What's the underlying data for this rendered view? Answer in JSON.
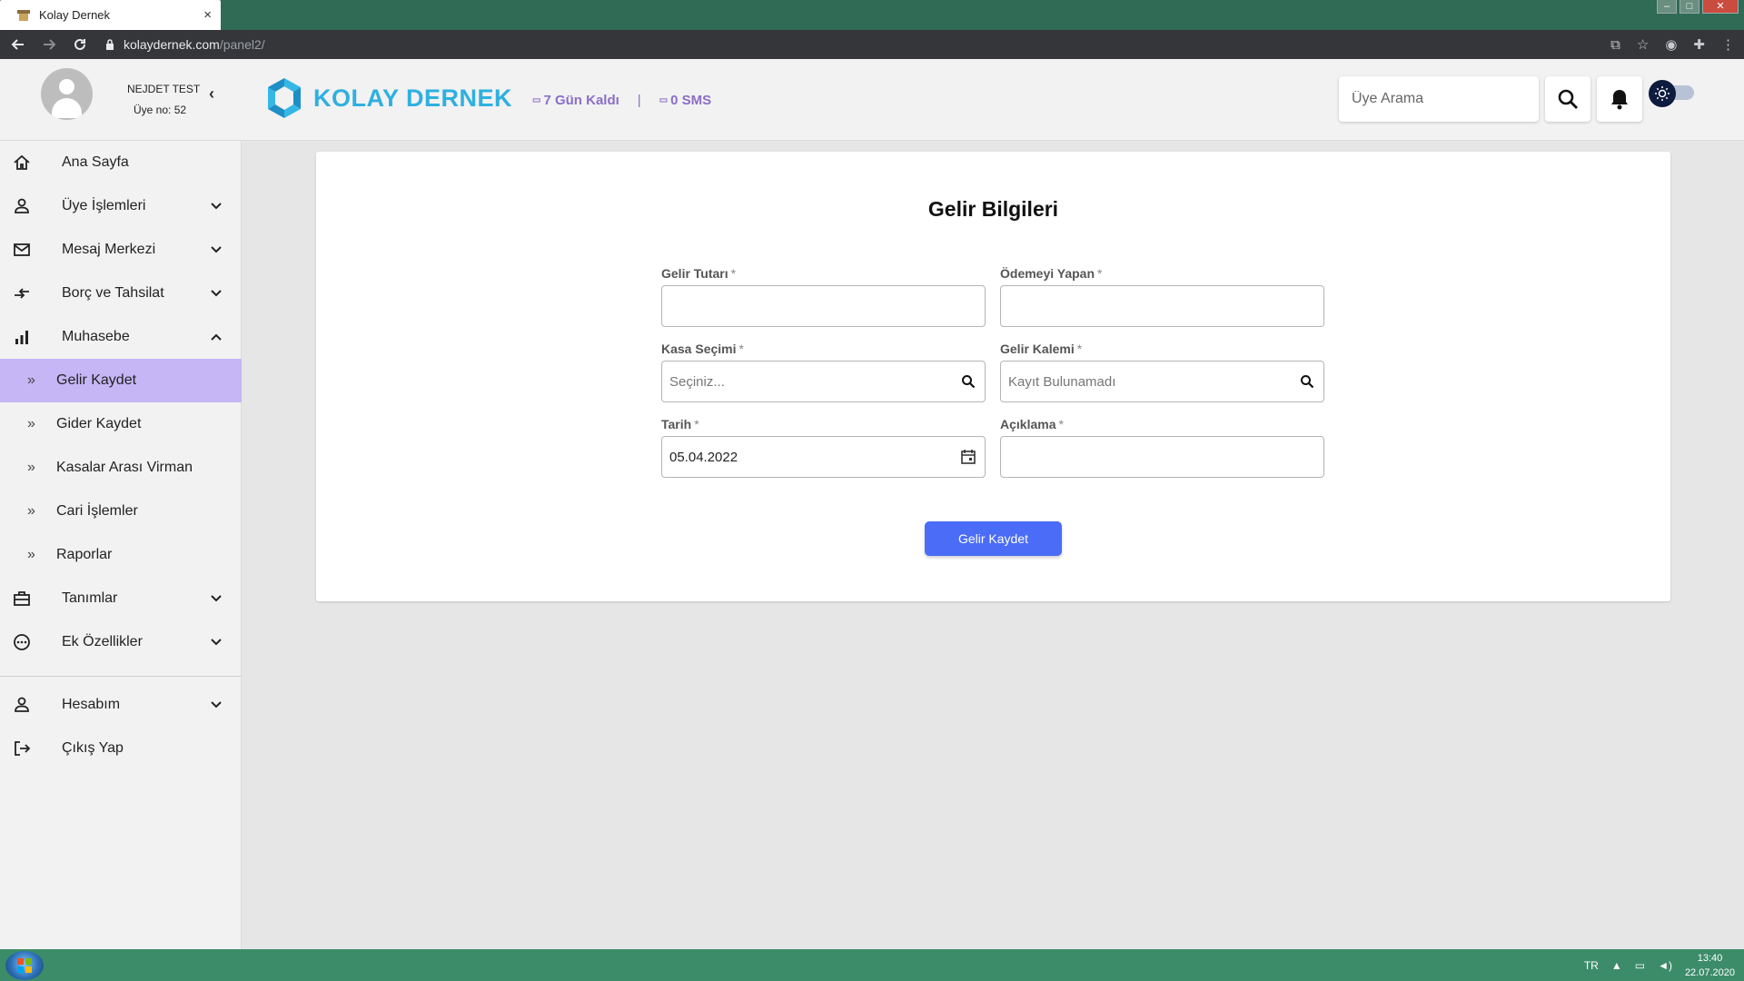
{
  "browser": {
    "tab_title": "Kolay Dernek",
    "tab_close": "×",
    "url_host": "kolaydernek.com",
    "url_path": "/panel2/"
  },
  "header": {
    "user_name": "NEJDET TEST",
    "user_no": "Üye no: 52",
    "logo_text": "KOLAY DERNEK",
    "trial_days": "7 Gün Kaldı",
    "separator": "|",
    "sms_count": "0 SMS",
    "search_placeholder": "Üye Arama"
  },
  "sidebar": {
    "items": [
      {
        "label": "Ana Sayfa",
        "icon": "home-icon",
        "has_chevron": false
      },
      {
        "label": "Üye İşlemleri",
        "icon": "person-icon",
        "has_chevron": true
      },
      {
        "label": "Mesaj Merkezi",
        "icon": "mail-icon",
        "has_chevron": true
      },
      {
        "label": "Borç ve Tahsilat",
        "icon": "transfer-icon",
        "has_chevron": true
      },
      {
        "label": "Muhasebe",
        "icon": "bar-chart-icon",
        "has_chevron": true,
        "expanded": true
      }
    ],
    "sub_items": [
      {
        "label": "Gelir Kaydet",
        "active": true
      },
      {
        "label": "Gider Kaydet"
      },
      {
        "label": "Kasalar Arası Virman"
      },
      {
        "label": "Cari İşlemler"
      },
      {
        "label": "Raporlar"
      }
    ],
    "bottom_items": [
      {
        "label": "Tanımlar",
        "icon": "briefcase-icon"
      },
      {
        "label": "Ek Özellikler",
        "icon": "more-circle-icon"
      }
    ],
    "account_items": [
      {
        "label": "Hesabım",
        "icon": "person-icon"
      },
      {
        "label": "Çıkış Yap",
        "icon": "logout-icon"
      }
    ],
    "bullet": "»"
  },
  "form": {
    "title": "Gelir Bilgileri",
    "required_mark": "*",
    "fields": {
      "amount": {
        "label": "Gelir Tutarı",
        "value": ""
      },
      "payer": {
        "label": "Ödemeyi Yapan",
        "value": ""
      },
      "cashbox": {
        "label": "Kasa Seçimi",
        "placeholder": "Seçiniz..."
      },
      "income_item": {
        "label": "Gelir Kalemi",
        "placeholder": "Kayıt Bulunamadı"
      },
      "date": {
        "label": "Tarih",
        "value": "05.04.2022"
      },
      "description": {
        "label": "Açıklama",
        "value": ""
      }
    },
    "submit_label": "Gelir Kaydet"
  },
  "taskbar": {
    "language": "TR",
    "time": "13:40",
    "date": "22.07.2020"
  },
  "colors": {
    "accent": "#4a6cf7",
    "active_nav": "#c6b6f5",
    "logo": "#2fb0e0",
    "trial_text": "#8a6ec9"
  }
}
